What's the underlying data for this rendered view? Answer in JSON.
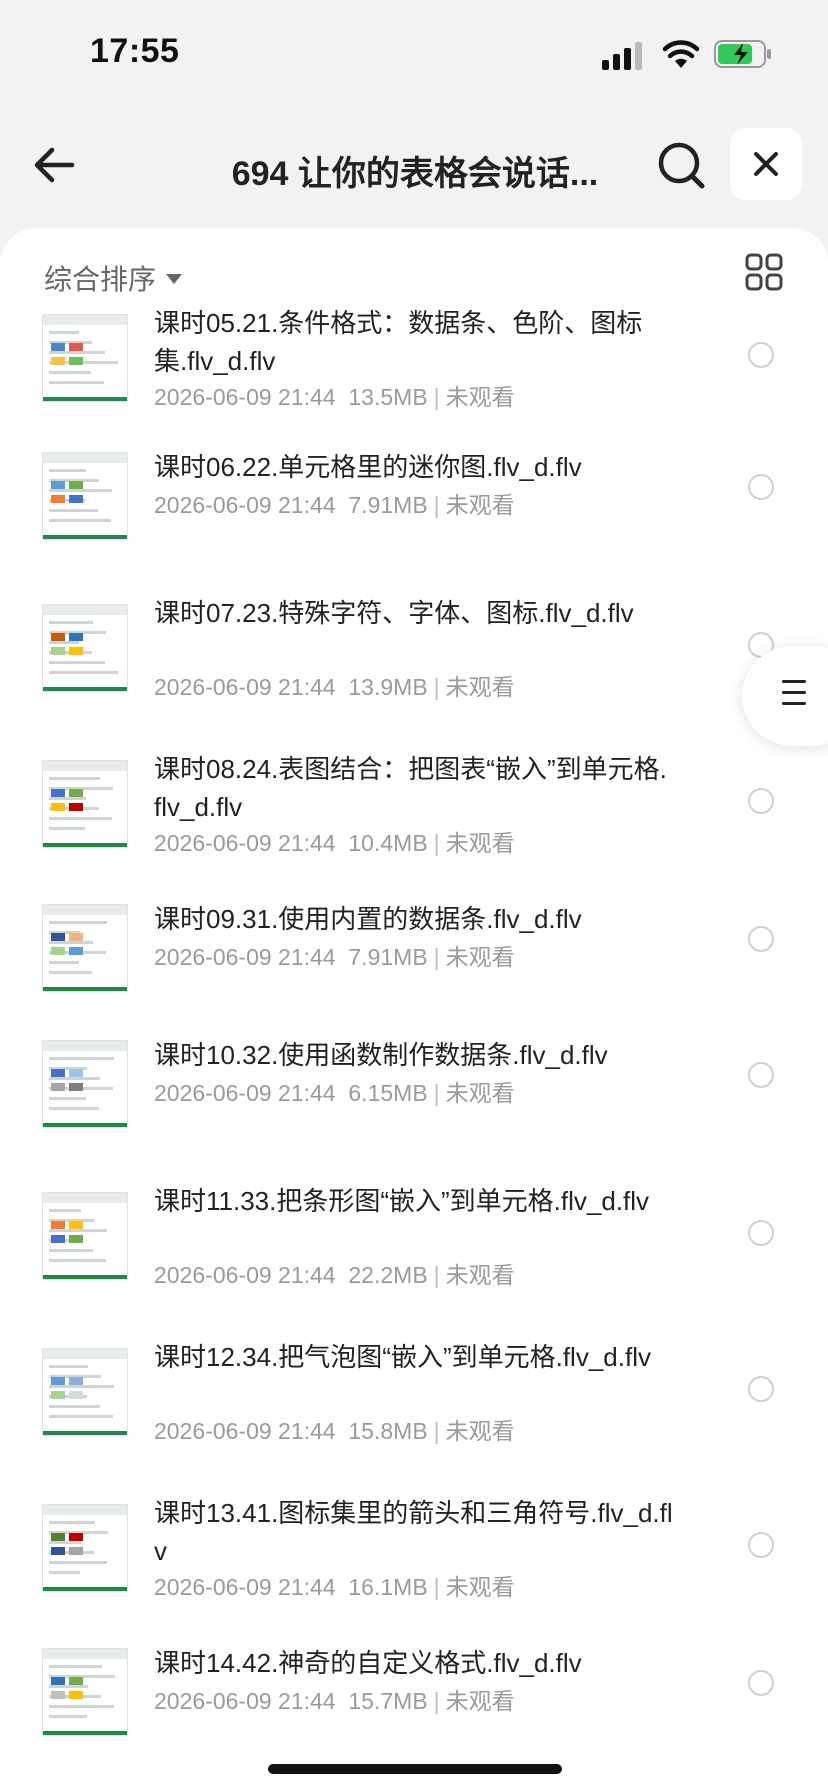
{
  "status_bar": {
    "time": "17:55"
  },
  "header": {
    "title": "694 让你的表格会说话..."
  },
  "toolbar": {
    "sort_label": "综合排序"
  },
  "files": [
    {
      "name": "课时05.21.条件格式：数据条、色阶、图标集.flv_d.flv",
      "date": "2026-06-09 21:44",
      "size": "13.5MB",
      "status": "未观看"
    },
    {
      "name": "课时06.22.单元格里的迷你图.flv_d.flv",
      "date": "2026-06-09 21:44",
      "size": "7.91MB",
      "status": "未观看"
    },
    {
      "name": "课时07.23.特殊字符、字体、图标.flv_d.flv",
      "date": "2026-06-09 21:44",
      "size": "13.9MB",
      "status": "未观看"
    },
    {
      "name": "课时08.24.表图结合：把图表“嵌入”到单元格.flv_d.flv",
      "date": "2026-06-09 21:44",
      "size": "10.4MB",
      "status": "未观看"
    },
    {
      "name": "课时09.31.使用内置的数据条.flv_d.flv",
      "date": "2026-06-09 21:44",
      "size": "7.91MB",
      "status": "未观看"
    },
    {
      "name": "课时10.32.使用函数制作数据条.flv_d.flv",
      "date": "2026-06-09 21:44",
      "size": "6.15MB",
      "status": "未观看"
    },
    {
      "name": "课时11.33.把条形图“嵌入”到单元格.flv_d.flv",
      "date": "2026-06-09 21:44",
      "size": "22.2MB",
      "status": "未观看"
    },
    {
      "name": "课时12.34.把气泡图“嵌入”到单元格.flv_d.flv",
      "date": "2026-06-09 21:44",
      "size": "15.8MB",
      "status": "未观看"
    },
    {
      "name": "课时13.41.图标集里的箭头和三角符号.flv_d.flv",
      "date": "2026-06-09 21:44",
      "size": "16.1MB",
      "status": "未观看"
    },
    {
      "name": "课时14.42.神奇的自定义格式.flv_d.flv",
      "date": "2026-06-09 21:44",
      "size": "15.7MB",
      "status": "未观看"
    }
  ]
}
